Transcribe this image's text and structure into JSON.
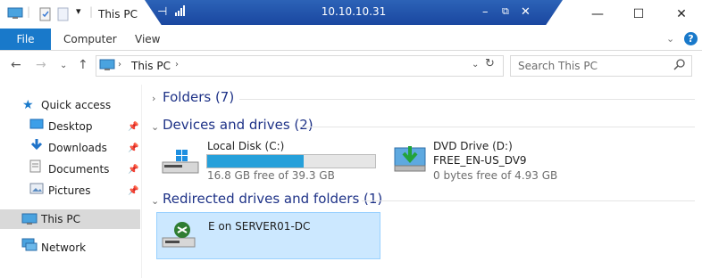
{
  "window": {
    "title": "This PC",
    "remote_host": "10.10.10.31"
  },
  "ribbon": {
    "tabs": [
      "File",
      "Computer",
      "View"
    ]
  },
  "address": {
    "path": "This PC",
    "search_placeholder": "Search This PC"
  },
  "sidebar": {
    "quick_access": "Quick access",
    "items": [
      {
        "label": "Desktop",
        "icon": "desktop-icon"
      },
      {
        "label": "Downloads",
        "icon": "download-icon"
      },
      {
        "label": "Documents",
        "icon": "document-icon"
      },
      {
        "label": "Pictures",
        "icon": "pictures-icon"
      }
    ],
    "this_pc": "This PC",
    "network": "Network"
  },
  "content": {
    "folders_header": "Folders (7)",
    "devices_header": "Devices and drives (2)",
    "drives": [
      {
        "name": "Local Disk (C:)",
        "free_text": "16.8 GB free of 39.3 GB",
        "used_fraction": 0.573
      },
      {
        "name": "DVD Drive (D:)",
        "volume": "FREE_EN-US_DV9",
        "free_text": "0 bytes free of 4.93 GB"
      }
    ],
    "redirected_header": "Redirected drives and folders (1)",
    "redirected": [
      {
        "name": "E on SERVER01-DC"
      }
    ]
  },
  "colors": {
    "accent": "#1979ca",
    "header_text": "#1e3287",
    "progress": "#26a0da",
    "selection": "#cce8ff"
  }
}
